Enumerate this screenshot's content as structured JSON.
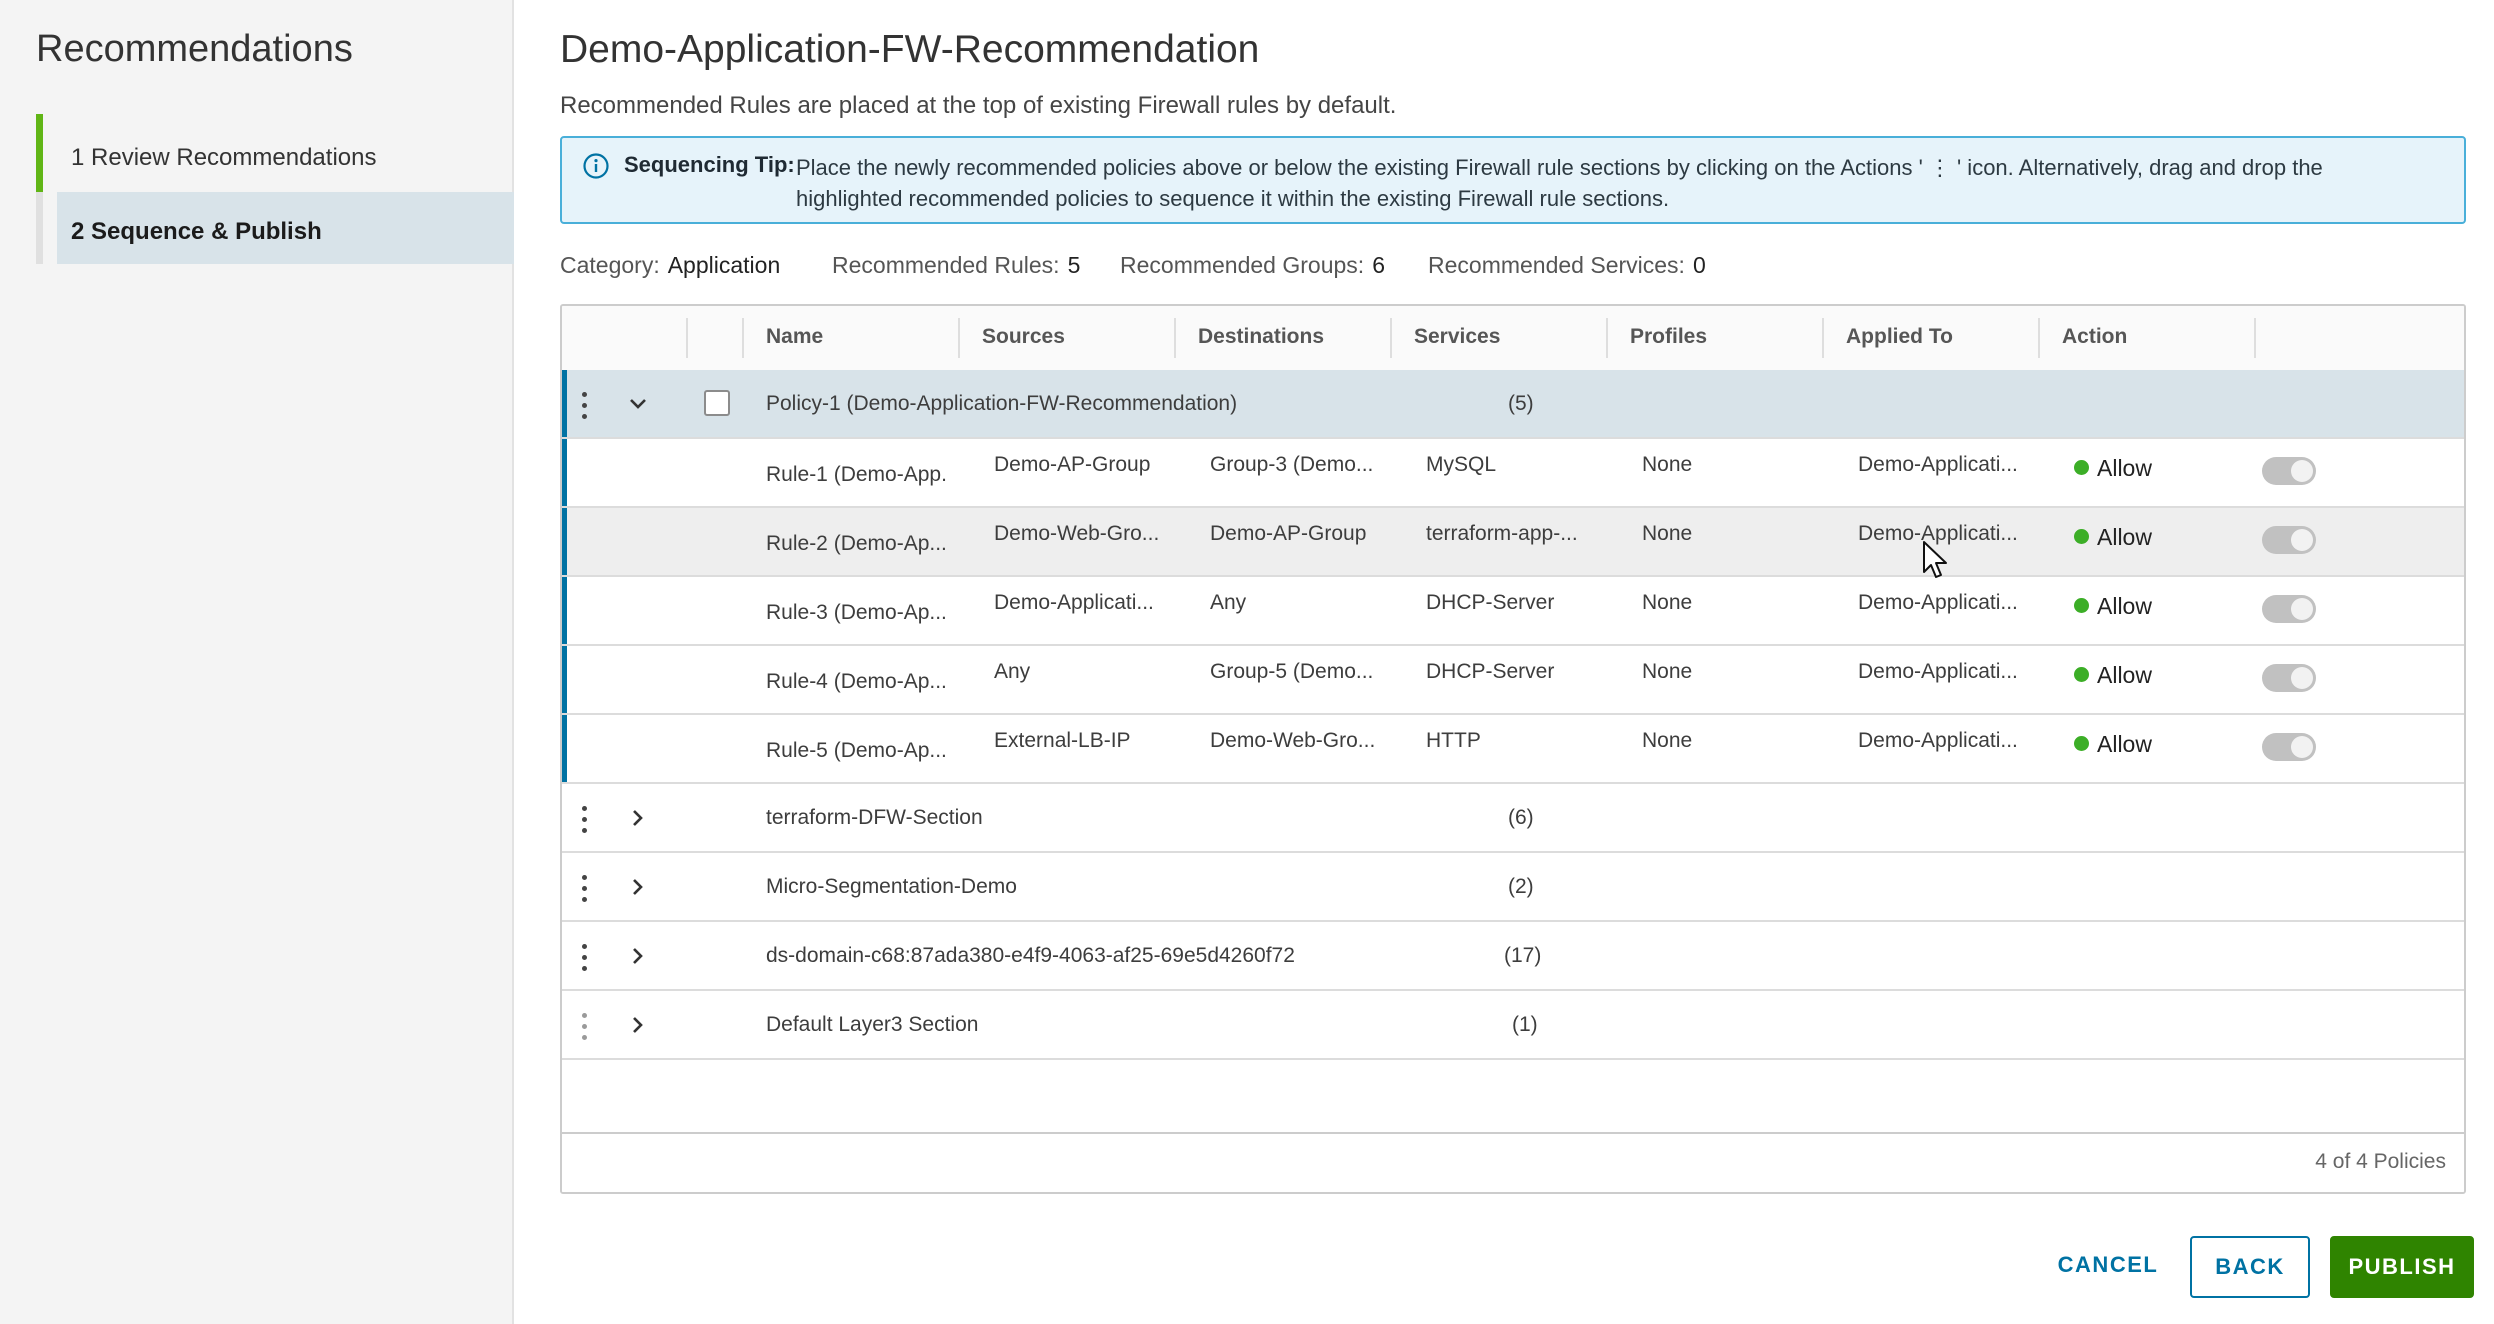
{
  "sidebar": {
    "title": "Recommendations",
    "steps": [
      {
        "label": "1 Review Recommendations"
      },
      {
        "label": "2 Sequence & Publish"
      }
    ]
  },
  "main": {
    "title": "Demo-Application-FW-Recommendation",
    "subtitle": "Recommended Rules are placed at the top of existing Firewall rules by default.",
    "tip": {
      "label": "Sequencing Tip:",
      "text": "Place the newly recommended policies above or below the existing Firewall rule sections by clicking on the Actions ' ⋮ ' icon.   Alternatively, drag and drop the highlighted recommended policies to sequence it within the existing Firewall rule sections."
    },
    "summary": {
      "category_label": "Category:",
      "category_value": "Application",
      "rules_label": "Recommended Rules:",
      "rules_value": "5",
      "groups_label": "Recommended Groups:",
      "groups_value": "6",
      "services_label": "Recommended Services:",
      "services_value": "0"
    }
  },
  "grid": {
    "columns": [
      "Name",
      "Sources",
      "Destinations",
      "Services",
      "Profiles",
      "Applied To",
      "Action"
    ],
    "open_policy": {
      "name": "Policy-1 (Demo-Application-FW-Recommendation)",
      "count": "(5)"
    },
    "rules": [
      {
        "name": "Rule-1 (Demo-App...",
        "sources": "Demo-AP-Group",
        "destinations": "Group-3 (Demo...",
        "services": "MySQL",
        "profiles": "None",
        "applied_to": "Demo-Applicati...",
        "action": "Allow"
      },
      {
        "name": "Rule-2 (Demo-Ap...",
        "sources": "Demo-Web-Gro...",
        "destinations": "Demo-AP-Group",
        "services": "terraform-app-...",
        "profiles": "None",
        "applied_to": "Demo-Applicati...",
        "action": "Allow"
      },
      {
        "name": "Rule-3 (Demo-Ap...",
        "sources": "Demo-Applicati...",
        "destinations": "Any",
        "services": "DHCP-Server",
        "profiles": "None",
        "applied_to": "Demo-Applicati...",
        "action": "Allow"
      },
      {
        "name": "Rule-4 (Demo-Ap...",
        "sources": "Any",
        "destinations": "Group-5 (Demo...",
        "services": "DHCP-Server",
        "profiles": "None",
        "applied_to": "Demo-Applicati...",
        "action": "Allow"
      },
      {
        "name": "Rule-5 (Demo-Ap...",
        "sources": "External-LB-IP",
        "destinations": "Demo-Web-Gro...",
        "services": "HTTP",
        "profiles": "None",
        "applied_to": "Demo-Applicati...",
        "action": "Allow"
      }
    ],
    "sections": [
      {
        "name": "terraform-DFW-Section",
        "count": "(6)"
      },
      {
        "name": "Micro-Segmentation-Demo",
        "count": "(2)"
      },
      {
        "name": "ds-domain-c68:87ada380-e4f9-4063-af25-69e5d4260f72",
        "count": "(17)"
      },
      {
        "name": "Default Layer3 Section",
        "count": "(1)"
      }
    ],
    "footer": "4 of 4 Policies"
  },
  "buttons": {
    "cancel": "CANCEL",
    "back": "BACK",
    "publish": "PUBLISH"
  },
  "colors": {
    "accent_blue": "#0072a3",
    "step_green": "#60b515",
    "allow_green": "#3cae27",
    "publish_green": "#2f8400",
    "tip_bg": "#e6f3fa"
  }
}
